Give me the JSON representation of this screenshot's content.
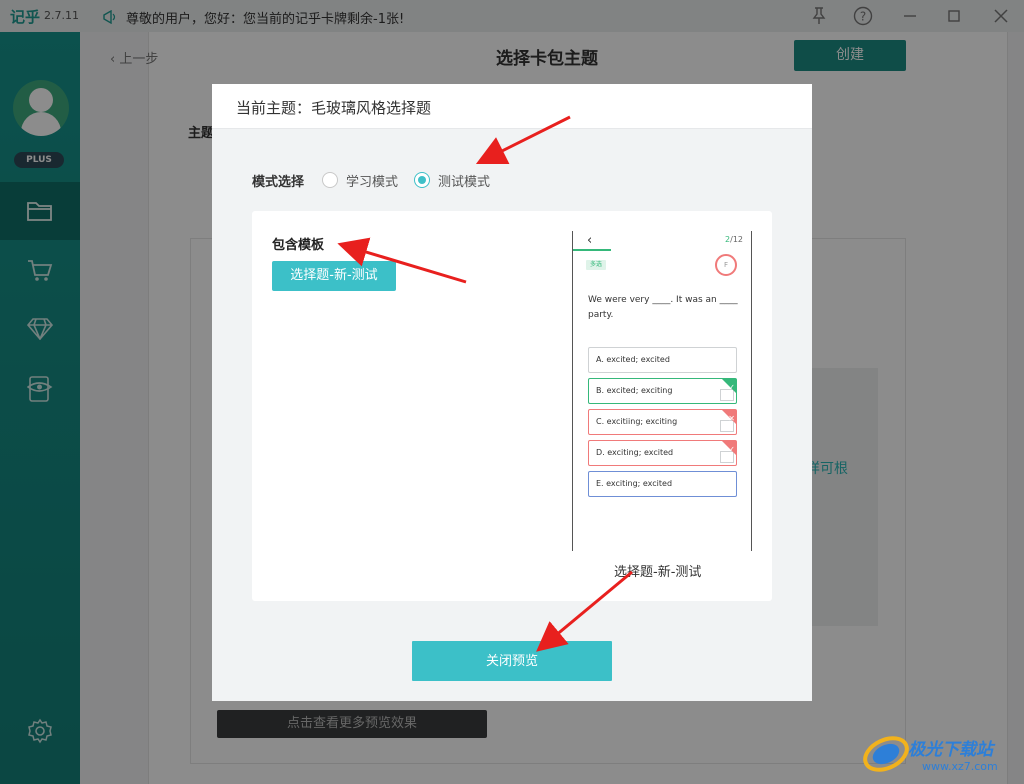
{
  "app": {
    "logo": "记乎",
    "version": "2.7.11",
    "notice": "尊敬的用户，您好：您当前的记乎卡牌剩余-1张!"
  },
  "sidebar": {
    "badge": "PLUS",
    "items": [
      {
        "icon": "folder-icon",
        "active": true
      },
      {
        "icon": "cart-icon",
        "active": false
      },
      {
        "icon": "diamond-icon",
        "active": false
      },
      {
        "icon": "preview-icon",
        "active": false
      }
    ],
    "settings_icon": "gear-icon"
  },
  "page": {
    "back_label": "上一步",
    "title": "选择卡包主题",
    "create_label": "创建",
    "theme_label": "主题",
    "side_text": "样可根",
    "more_preview_label": "点击查看更多预览效果"
  },
  "modal": {
    "title": "当前主题：毛玻璃风格选择题",
    "mode_label": "模式选择",
    "modes": [
      {
        "label": "学习模式",
        "checked": false
      },
      {
        "label": "测试模式",
        "checked": true
      }
    ],
    "template_heading": "包含模板",
    "template_chip": "选择题-新-测试",
    "preview_caption": "选择题-新-测试",
    "close_label": "关闭预览",
    "phone": {
      "back": "‹",
      "counter_current": "2",
      "counter_total": "/12",
      "tag": "多选",
      "timer": "F",
      "question": "We were very ____. It was an ____ party.",
      "options": [
        {
          "text": "A. excited; excited",
          "state": "normal"
        },
        {
          "text": "B. excited; exciting",
          "state": "correct"
        },
        {
          "text": "C. excitiing; exciting",
          "state": "wrong"
        },
        {
          "text": "D. exciting; excited",
          "state": "wrong-check"
        },
        {
          "text": "E. exciting; excited",
          "state": "selected"
        }
      ]
    }
  },
  "watermark": {
    "text": "极光下载站",
    "url": "www.xz7.com"
  },
  "colors": {
    "accent": "#3cc0c8",
    "sidebar": "#17948c",
    "arrow": "#e8201e",
    "correct": "#35b87a",
    "wrong": "#f07a7a"
  }
}
